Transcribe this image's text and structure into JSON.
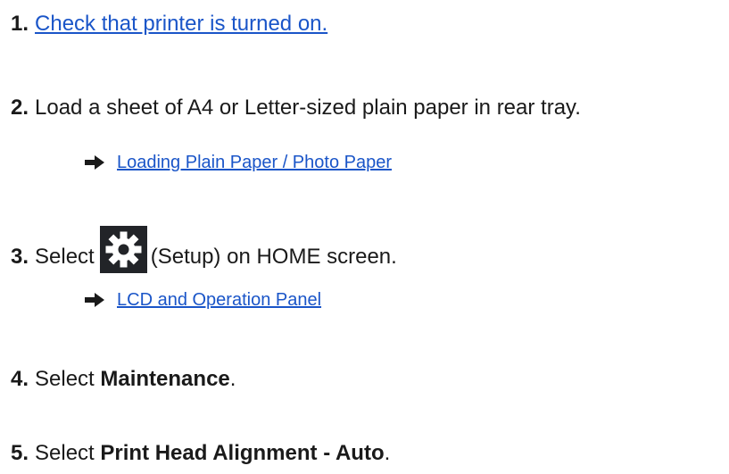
{
  "steps": [
    {
      "num": "1.",
      "link_text": "Check that printer is turned on."
    },
    {
      "num": "2.",
      "text": "Load a sheet of A4 or Letter-sized plain paper in rear tray.",
      "sub_link": "Loading Plain Paper / Photo Paper"
    },
    {
      "num": "3.",
      "text_before": "Select",
      "icon": "gear-icon",
      "text_after": "(Setup) on HOME screen.",
      "sub_link": "LCD and Operation Panel"
    },
    {
      "num": "4.",
      "text_before": "Select",
      "bold": "Maintenance",
      "text_after": "."
    },
    {
      "num": "5.",
      "text_before": "Select",
      "bold": "Print Head Alignment - Auto",
      "text_after": "."
    }
  ],
  "icons": {
    "sub_arrow": "right-arrow-icon",
    "setup": "gear-icon"
  },
  "colors": {
    "link": "#1a55c8",
    "text": "#1a1a1a",
    "icon_bg": "#222428"
  }
}
